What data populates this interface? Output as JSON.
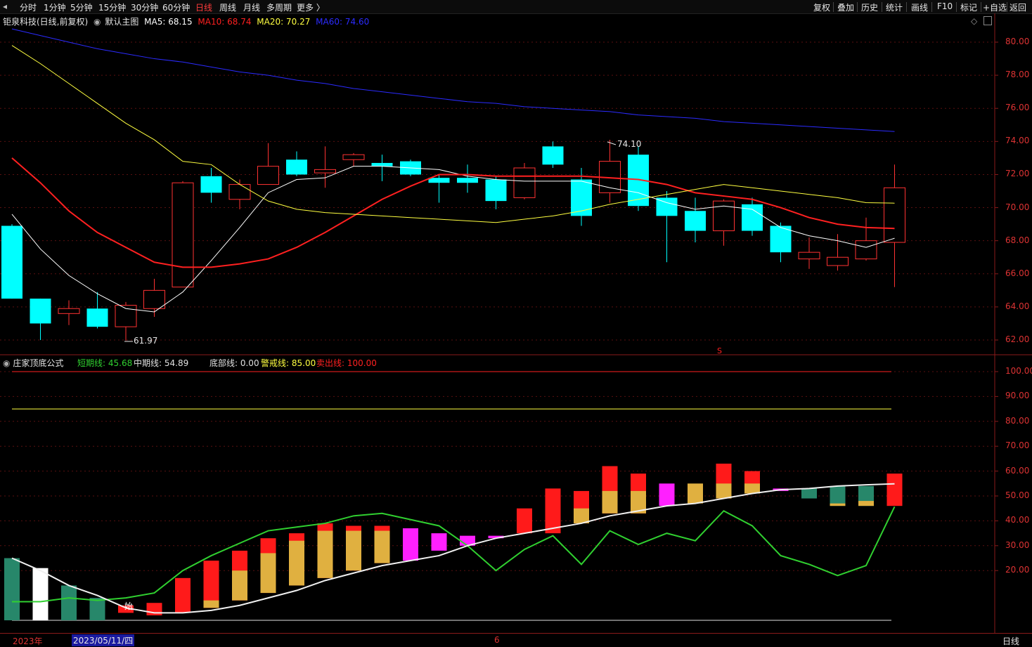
{
  "toolbar": {
    "tabs": [
      "分时",
      "1分钟",
      "5分钟",
      "15分钟",
      "30分钟",
      "60分钟",
      "日线",
      "周线",
      "月线",
      "多周期",
      "更多 〉"
    ],
    "active_tab": "日线",
    "right": [
      "复权",
      "叠加",
      "历史",
      "统计",
      "画线",
      "F10",
      "标记",
      "+自选",
      "返回"
    ]
  },
  "main_panel": {
    "stock_title": "钜泉科技(日线,前复权)",
    "indicator_name": "默认主图",
    "ma": [
      {
        "label": "MA5: 68.15",
        "color": "#ffffff"
      },
      {
        "label": "MA10: 68.74",
        "color": "#ff2020"
      },
      {
        "label": "MA20: 70.27",
        "color": "#ffff40"
      },
      {
        "label": "MA60: 74.60",
        "color": "#2b2bff"
      }
    ],
    "high_marker": "74.10",
    "low_marker": "61.97",
    "s_marker": "S",
    "y_ticks": [
      "80.00",
      "78.00",
      "76.00",
      "74.00",
      "72.00",
      "70.00",
      "68.00",
      "66.00",
      "64.00",
      "62.00"
    ]
  },
  "sub_panel": {
    "indicator_name": "庄家顶底公式",
    "legend": [
      {
        "label": "短期线: 45.68",
        "color": "#30d030"
      },
      {
        "label": "中期线: 54.89",
        "color": "#e0e0e0"
      },
      {
        "label": "底部线: 0.00",
        "color": "#e0e0e0"
      },
      {
        "label": "警戒线: 85.00",
        "color": "#ffff40"
      },
      {
        "label": "卖出线: 100.00",
        "color": "#ff2020"
      }
    ],
    "start_marker": "始",
    "y_ticks": [
      "100.00",
      "90.00",
      "80.00",
      "70.00",
      "60.00",
      "50.00",
      "40.00",
      "30.00",
      "20.00"
    ]
  },
  "bottom_bar": {
    "year": "2023年",
    "cursor_date": "2023/05/11/四",
    "month_mark": "6",
    "period": "日线"
  },
  "chart_data": [
    {
      "type": "candlestick",
      "title": "钜泉科技(日线,前复权)",
      "ylim": [
        61.5,
        81.5
      ],
      "candles": [
        {
          "o": 68.9,
          "h": 69.0,
          "l": 64.5,
          "c": 64.5
        },
        {
          "o": 64.5,
          "h": 64.5,
          "l": 62.0,
          "c": 63.0
        },
        {
          "o": 63.6,
          "h": 64.4,
          "l": 62.9,
          "c": 63.9
        },
        {
          "o": 63.9,
          "h": 64.9,
          "l": 62.7,
          "c": 62.8
        },
        {
          "o": 62.8,
          "h": 64.3,
          "l": 61.97,
          "c": 64.1
        },
        {
          "o": 63.9,
          "h": 65.7,
          "l": 63.4,
          "c": 65.0
        },
        {
          "o": 65.2,
          "h": 71.6,
          "l": 65.2,
          "c": 71.5
        },
        {
          "o": 71.9,
          "h": 72.4,
          "l": 70.3,
          "c": 70.9
        },
        {
          "o": 70.5,
          "h": 71.7,
          "l": 69.9,
          "c": 71.4
        },
        {
          "o": 71.4,
          "h": 73.9,
          "l": 71.4,
          "c": 72.5
        },
        {
          "o": 72.9,
          "h": 73.4,
          "l": 71.9,
          "c": 72.0
        },
        {
          "o": 72.1,
          "h": 73.7,
          "l": 71.2,
          "c": 72.3
        },
        {
          "o": 72.9,
          "h": 73.3,
          "l": 72.5,
          "c": 73.2
        },
        {
          "o": 72.7,
          "h": 73.2,
          "l": 71.6,
          "c": 72.5
        },
        {
          "o": 72.8,
          "h": 72.9,
          "l": 71.9,
          "c": 72.0
        },
        {
          "o": 71.8,
          "h": 72.0,
          "l": 70.3,
          "c": 71.5
        },
        {
          "o": 71.8,
          "h": 72.6,
          "l": 70.9,
          "c": 71.5
        },
        {
          "o": 71.7,
          "h": 71.9,
          "l": 69.9,
          "c": 70.4
        },
        {
          "o": 70.6,
          "h": 72.7,
          "l": 70.5,
          "c": 72.4
        },
        {
          "o": 73.7,
          "h": 74.0,
          "l": 72.4,
          "c": 72.6
        },
        {
          "o": 71.7,
          "h": 72.4,
          "l": 68.9,
          "c": 69.5
        },
        {
          "o": 70.9,
          "h": 74.1,
          "l": 70.3,
          "c": 72.8
        },
        {
          "o": 73.2,
          "h": 73.7,
          "l": 69.8,
          "c": 70.1
        },
        {
          "o": 70.6,
          "h": 71.0,
          "l": 66.7,
          "c": 69.5
        },
        {
          "o": 69.8,
          "h": 70.6,
          "l": 67.9,
          "c": 68.6
        },
        {
          "o": 68.6,
          "h": 70.5,
          "l": 67.7,
          "c": 70.4
        },
        {
          "o": 70.2,
          "h": 70.6,
          "l": 68.3,
          "c": 68.6
        },
        {
          "o": 68.9,
          "h": 69.1,
          "l": 66.7,
          "c": 67.3
        },
        {
          "o": 66.9,
          "h": 68.2,
          "l": 66.3,
          "c": 67.3
        },
        {
          "o": 66.5,
          "h": 68.4,
          "l": 66.2,
          "c": 67.0
        },
        {
          "o": 66.9,
          "h": 69.4,
          "l": 66.8,
          "c": 68.0
        },
        {
          "o": 67.9,
          "h": 72.6,
          "l": 65.2,
          "c": 71.2
        }
      ],
      "series": [
        {
          "name": "MA5",
          "values": [
            69.6,
            67.5,
            65.9,
            64.8,
            63.9,
            63.7,
            64.9,
            66.8,
            68.8,
            70.9,
            71.7,
            71.8,
            72.5,
            72.5,
            72.4,
            72.3,
            71.9,
            71.7,
            71.6,
            71.6,
            71.6,
            71.2,
            70.9,
            70.3,
            69.9,
            70.1,
            69.9,
            68.8,
            68.3,
            68.0,
            67.6,
            68.15
          ]
        },
        {
          "name": "MA10",
          "values": [
            73.0,
            71.5,
            69.8,
            68.5,
            67.6,
            66.7,
            66.4,
            66.4,
            66.6,
            66.9,
            67.6,
            68.5,
            69.5,
            70.5,
            71.3,
            72.0,
            72.0,
            71.9,
            71.9,
            71.9,
            71.9,
            71.8,
            71.7,
            71.4,
            70.9,
            70.7,
            70.5,
            70.0,
            69.4,
            69.0,
            68.8,
            68.74
          ]
        },
        {
          "name": "MA20",
          "values": [
            79.8,
            78.7,
            77.5,
            76.3,
            75.1,
            74.1,
            72.8,
            72.6,
            71.4,
            70.4,
            69.9,
            69.7,
            69.6,
            69.5,
            69.4,
            69.3,
            69.2,
            69.1,
            69.3,
            69.5,
            69.8,
            70.2,
            70.5,
            70.8,
            71.1,
            71.4,
            71.2,
            71.0,
            70.8,
            70.6,
            70.3,
            70.27
          ]
        },
        {
          "name": "MA60",
          "values": [
            80.8,
            80.4,
            80.0,
            79.6,
            79.3,
            79.0,
            78.8,
            78.5,
            78.2,
            78.0,
            77.7,
            77.5,
            77.2,
            77.0,
            76.8,
            76.6,
            76.4,
            76.3,
            76.1,
            76.0,
            75.9,
            75.8,
            75.6,
            75.5,
            75.4,
            75.2,
            75.1,
            75.0,
            74.9,
            74.8,
            74.7,
            74.6
          ]
        }
      ]
    },
    {
      "type": "bar",
      "title": "庄家顶底公式",
      "ylim": [
        0,
        105
      ],
      "bars": [
        {
          "top": 25,
          "bot": 0,
          "color": "#27876a"
        },
        {
          "top": 21,
          "bot": 0,
          "color": "#ffffff"
        },
        {
          "top": 14,
          "bot": 0,
          "color": "#27876a"
        },
        {
          "top": 9,
          "bot": 0,
          "color": "#27876a"
        },
        {
          "top": 6,
          "bot": 3,
          "color": "#ff1a1a"
        },
        {
          "top": 7,
          "bot": 2,
          "color": "#ff1a1a"
        },
        {
          "top": 17,
          "bot": 3,
          "color": "#ff1a1a"
        },
        {
          "top": 24,
          "bot": 5,
          "color": "#ff1a1a"
        },
        {
          "top": 28,
          "bot": 8,
          "color": "#ff1a1a"
        },
        {
          "top": 33,
          "bot": 11,
          "color": "#ff1a1a"
        },
        {
          "top": 35,
          "bot": 14,
          "color": "#ff1a1a"
        },
        {
          "top": 39,
          "bot": 17,
          "color": "#ff1a1a"
        },
        {
          "top": 38,
          "bot": 20,
          "color": "#ff1a1a"
        },
        {
          "top": 38,
          "bot": 23,
          "color": "#ff1a1a"
        },
        {
          "top": 37,
          "bot": 24,
          "color": "#ff20ff"
        },
        {
          "top": 35,
          "bot": 28,
          "color": "#ff20ff"
        },
        {
          "top": 34,
          "bot": 30,
          "color": "#ff20ff"
        },
        {
          "top": 34,
          "bot": 33,
          "color": "#ff20ff"
        },
        {
          "top": 45,
          "bot": 35,
          "color": "#ff1a1a"
        },
        {
          "top": 53,
          "bot": 35,
          "color": "#ff1a1a"
        },
        {
          "top": 52,
          "bot": 39,
          "color": "#ff1a1a"
        },
        {
          "top": 62,
          "bot": 43,
          "color": "#ff1a1a"
        },
        {
          "top": 59,
          "bot": 43,
          "color": "#ff1a1a"
        },
        {
          "top": 55,
          "bot": 46,
          "color": "#ff20ff"
        },
        {
          "top": 55,
          "bot": 47,
          "color": "#e0b040"
        },
        {
          "top": 63,
          "bot": 49,
          "color": "#ff1a1a"
        },
        {
          "top": 60,
          "bot": 51,
          "color": "#ff1a1a"
        },
        {
          "top": 53,
          "bot": 52,
          "color": "#ff20ff"
        },
        {
          "top": 53,
          "bot": 49,
          "color": "#27876a"
        },
        {
          "top": 54,
          "bot": 46,
          "color": "#27876a"
        },
        {
          "top": 54,
          "bot": 46,
          "color": "#27876a"
        },
        {
          "top": 59,
          "bot": 46,
          "color": "#ff1a1a"
        }
      ],
      "gold_overlay": [
        {
          "i": 7,
          "top": 8,
          "bot": 5
        },
        {
          "i": 8,
          "top": 20,
          "bot": 8
        },
        {
          "i": 9,
          "top": 27,
          "bot": 11
        },
        {
          "i": 10,
          "top": 32,
          "bot": 14
        },
        {
          "i": 11,
          "top": 36,
          "bot": 17
        },
        {
          "i": 12,
          "top": 36,
          "bot": 20
        },
        {
          "i": 13,
          "top": 36,
          "bot": 23
        },
        {
          "i": 20,
          "top": 45,
          "bot": 39
        },
        {
          "i": 21,
          "top": 52,
          "bot": 43
        },
        {
          "i": 22,
          "top": 52,
          "bot": 43
        },
        {
          "i": 25,
          "top": 55,
          "bot": 49
        },
        {
          "i": 26,
          "top": 55,
          "bot": 51
        },
        {
          "i": 30,
          "top": 48,
          "bot": 46
        },
        {
          "i": 29,
          "top": 47,
          "bot": 46
        }
      ],
      "series": [
        {
          "name": "短期线",
          "values": [
            7.5,
            7.5,
            9,
            8,
            9,
            11,
            20,
            26,
            31,
            36,
            37.5,
            39,
            42,
            43,
            40.5,
            38,
            30,
            20,
            28.5,
            34,
            22.5,
            36,
            30.5,
            35,
            32,
            44,
            38,
            26,
            22.5,
            18,
            22,
            45.68
          ]
        },
        {
          "name": "中期线",
          "values": [
            25,
            20,
            14,
            10,
            5,
            3,
            3,
            4,
            6,
            9,
            12,
            16,
            19,
            22,
            24,
            26,
            30,
            33,
            35,
            37,
            39,
            42,
            44,
            46,
            47,
            49,
            51,
            52.5,
            53,
            54,
            54.5,
            54.89
          ]
        },
        {
          "name": "底部线",
          "values": [
            0
          ]
        },
        {
          "name": "警戒线",
          "values": [
            85
          ]
        },
        {
          "name": "卖出线",
          "values": [
            100
          ]
        }
      ]
    }
  ]
}
